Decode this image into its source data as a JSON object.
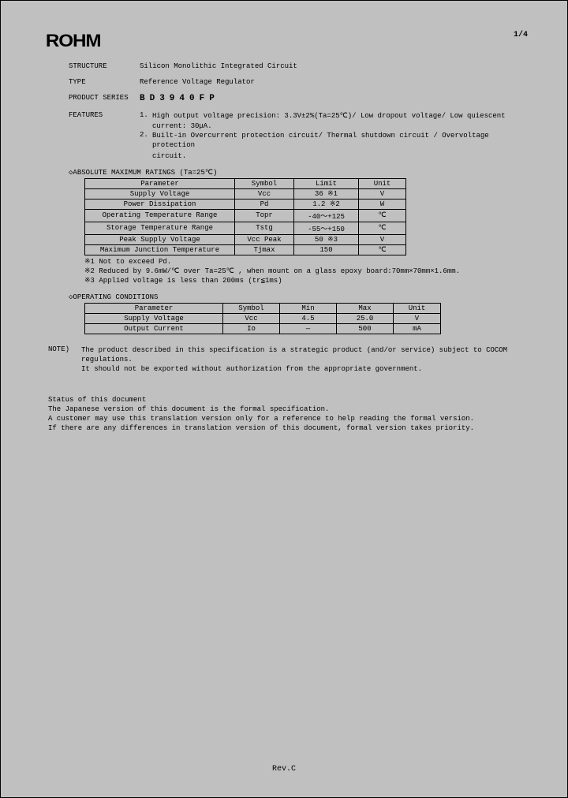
{
  "header": {
    "logo": "ROHM",
    "page": "1/4"
  },
  "fields": {
    "structure_label": "STRUCTURE",
    "structure_value": "Silicon Monolithic Integrated Circuit",
    "type_label": "TYPE",
    "type_value": "Reference Voltage Regulator",
    "series_label": "PRODUCT SERIES",
    "series_value": "BD3940FP",
    "features_label": "FEATURES",
    "features": [
      {
        "num": "1.",
        "text": "High output voltage precision: 3.3V±2%(Ta=25℃)/ Low dropout voltage/ Low quiescent",
        "cont": "current: 30μA."
      },
      {
        "num": "2.",
        "text": "Built-in Overcurrent protection circuit/ Thermal shutdown circuit / Overvoltage protection",
        "cont": "circuit."
      }
    ]
  },
  "abs_max": {
    "title": "◇ABSOLUTE MAXIMUM RATINGS (Ta=25℃)",
    "headers": {
      "param": "Parameter",
      "symbol": "Symbol",
      "limit": "Limit",
      "unit": "Unit"
    },
    "rows": [
      {
        "param": "Supply Voltage",
        "symbol": "Vcc",
        "limit": "36 ※1",
        "unit": "V"
      },
      {
        "param": "Power Dissipation",
        "symbol": "Pd",
        "limit": "1.2 ※2",
        "unit": "W"
      },
      {
        "param": "Operating Temperature Range",
        "symbol": "Topr",
        "limit": "-40～+125",
        "unit": "℃"
      },
      {
        "param": "Storage Temperature Range",
        "symbol": "Tstg",
        "limit": "-55～+150",
        "unit": "℃"
      },
      {
        "param": "Peak Supply Voltage",
        "symbol": "Vcc Peak",
        "limit": "50 ※3",
        "unit": "V"
      },
      {
        "param": "Maximum Junction Temperature",
        "symbol": "Tjmax",
        "limit": "150",
        "unit": "℃"
      }
    ],
    "notes": [
      "※1 Not to exceed Pd.",
      "※2 Reduced by 9.6mW/℃ over Ta=25℃ , when mount on a glass epoxy board:70mm×70mm×1.6mm.",
      "※3 Applied voltage is less than 200ms (tr≦1ms)"
    ]
  },
  "op_cond": {
    "title": "◇OPERATING CONDITIONS",
    "headers": {
      "param": "Parameter",
      "symbol": "Symbol",
      "min": "Min",
      "max": "Max",
      "unit": "Unit"
    },
    "rows": [
      {
        "param": "Supply Voltage",
        "symbol": "Vcc",
        "min": "4.5",
        "max": "25.0",
        "unit": "V"
      },
      {
        "param": "Output Current",
        "symbol": "Io",
        "min": "—",
        "max": "500",
        "unit": "mA"
      }
    ]
  },
  "note": {
    "label": "NOTE)",
    "line1": "The product described in this specification is a strategic product (and/or service) subject to COCOM regulations.",
    "line2": "It should not be exported without authorization from the appropriate government."
  },
  "status": {
    "l1": "Status of this document",
    "l2": "The Japanese version of this document is the formal specification.",
    "l3": "A customer may use this translation version only for a reference to help reading the formal version.",
    "l4": "If there are any differences in translation version of this document, formal version takes priority."
  },
  "revision": "Rev.C"
}
